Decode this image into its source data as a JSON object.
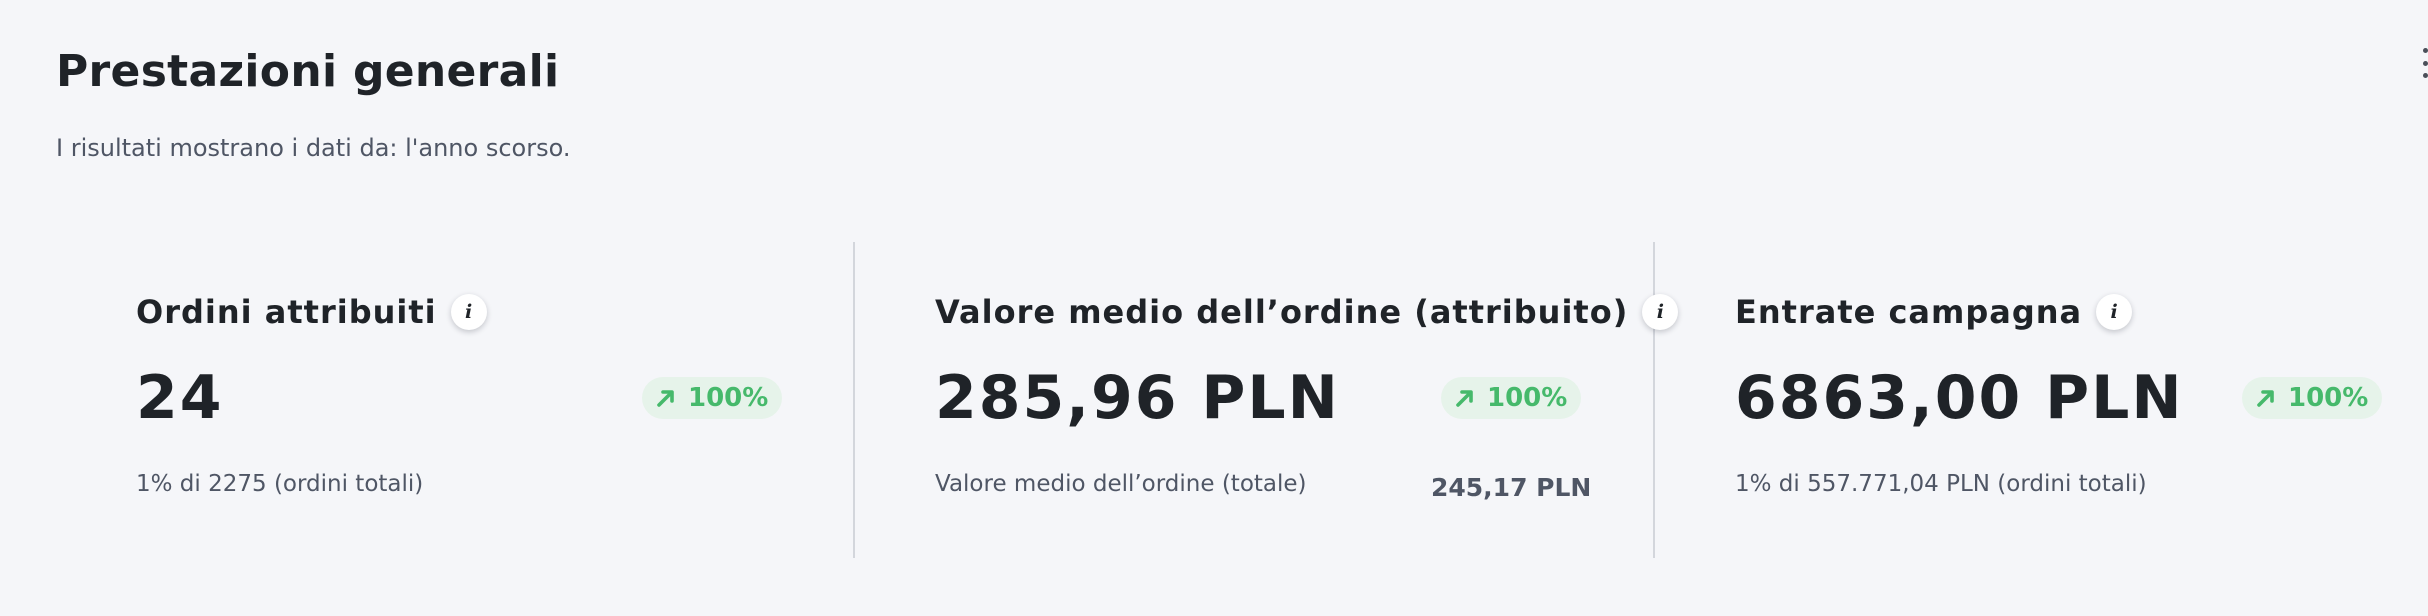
{
  "header": {
    "title": "Prestazioni generali",
    "subtitle": "I risultati mostrano i dati da: l'anno scorso.",
    "menu_icon": "vertical-ellipsis-icon"
  },
  "metrics": [
    {
      "title": "Ordini attribuiti",
      "info_icon": "info-icon",
      "info_glyph": "i",
      "value": "24",
      "change": "100%",
      "trend_icon": "trend-up-arrow-icon",
      "footnote": "1% di 2275 (ordini totali)"
    },
    {
      "title": "Valore medio dell’ordine (attribuito)",
      "info_icon": "info-icon",
      "info_glyph": "i",
      "value": "285,96 PLN",
      "change": "100%",
      "trend_icon": "trend-up-arrow-icon",
      "footnote": "Valore medio dell’ordine (totale)",
      "footnote_value": "245,17 PLN"
    },
    {
      "title": "Entrate campagna",
      "info_icon": "info-icon",
      "info_glyph": "i",
      "value": "6863,00 PLN",
      "change": "100%",
      "trend_icon": "trend-up-arrow-icon",
      "footnote": "1% di 557.771,04 PLN (ordini totali)"
    }
  ],
  "colors": {
    "background": "#f5f6f9",
    "text_primary": "#1f2328",
    "text_secondary": "#4f5665",
    "positive": "#46b96b",
    "positive_bg": "#e6f3ea",
    "divider": "#d3d6dc"
  }
}
